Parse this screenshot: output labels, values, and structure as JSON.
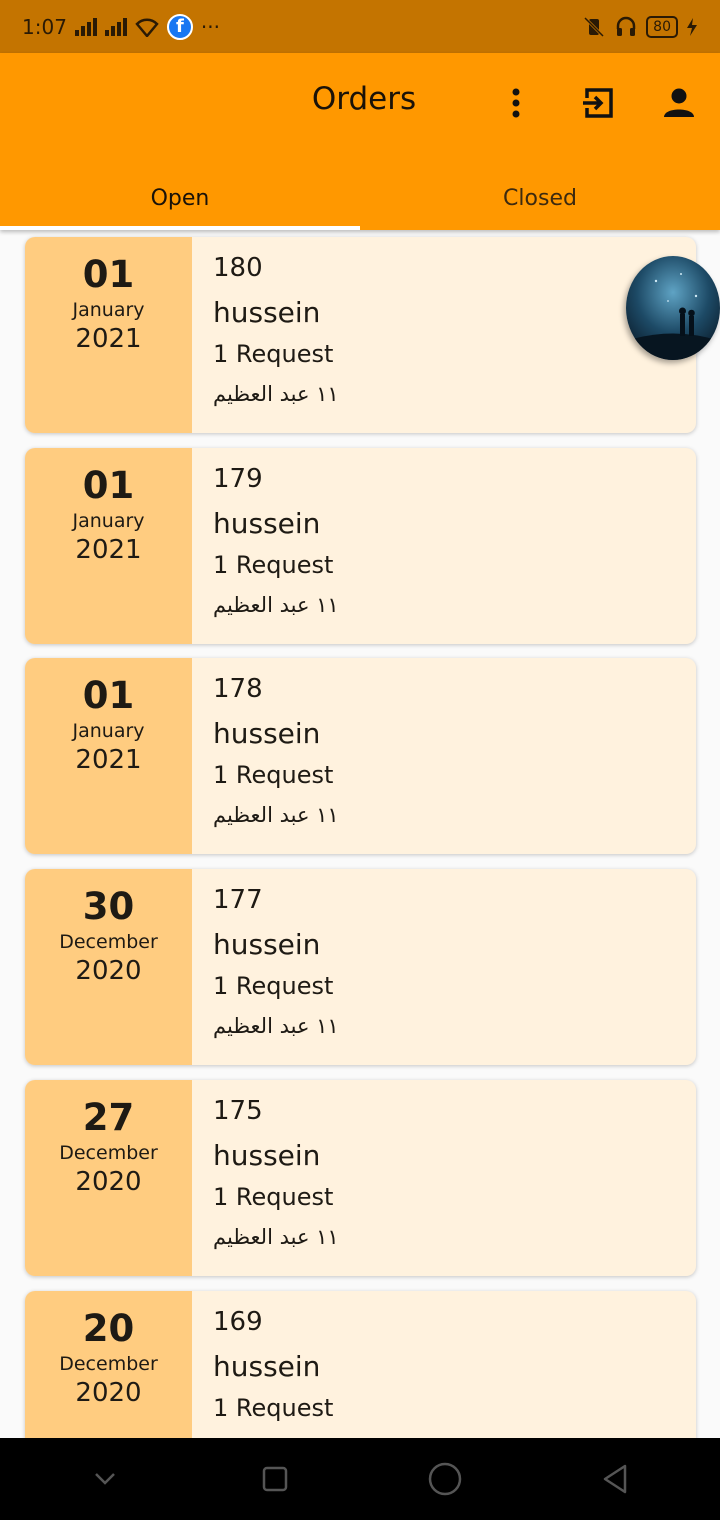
{
  "status_bar": {
    "time": "1:07",
    "battery": "80"
  },
  "app_bar": {
    "title": "Orders"
  },
  "tabs": [
    {
      "label": "Open",
      "active": true
    },
    {
      "label": "Closed",
      "active": false
    }
  ],
  "colors": {
    "app_bar": "#ff9800",
    "status_bar": "#c47400",
    "date_box": "#ffcc80",
    "card": "#fff2de"
  },
  "orders": [
    {
      "day": "01",
      "month": "January",
      "year": "2021",
      "number": "180",
      "customer": "hussein",
      "requests": "1 Request",
      "address": "١١ عبد العظيم"
    },
    {
      "day": "01",
      "month": "January",
      "year": "2021",
      "number": "179",
      "customer": "hussein",
      "requests": "1 Request",
      "address": "١١ عبد العظيم"
    },
    {
      "day": "01",
      "month": "January",
      "year": "2021",
      "number": "178",
      "customer": "hussein",
      "requests": "1 Request",
      "address": "١١ عبد العظيم"
    },
    {
      "day": "30",
      "month": "December",
      "year": "2020",
      "number": "177",
      "customer": "hussein",
      "requests": "1 Request",
      "address": "١١ عبد العظيم"
    },
    {
      "day": "27",
      "month": "December",
      "year": "2020",
      "number": "175",
      "customer": "hussein",
      "requests": "1 Request",
      "address": "١١ عبد العظيم"
    },
    {
      "day": "20",
      "month": "December",
      "year": "2020",
      "number": "169",
      "customer": "hussein",
      "requests": "1 Request",
      "address": ""
    }
  ],
  "icons": {
    "more": "more-vert-icon",
    "logout": "exit-to-app-icon",
    "profile": "person-icon"
  }
}
